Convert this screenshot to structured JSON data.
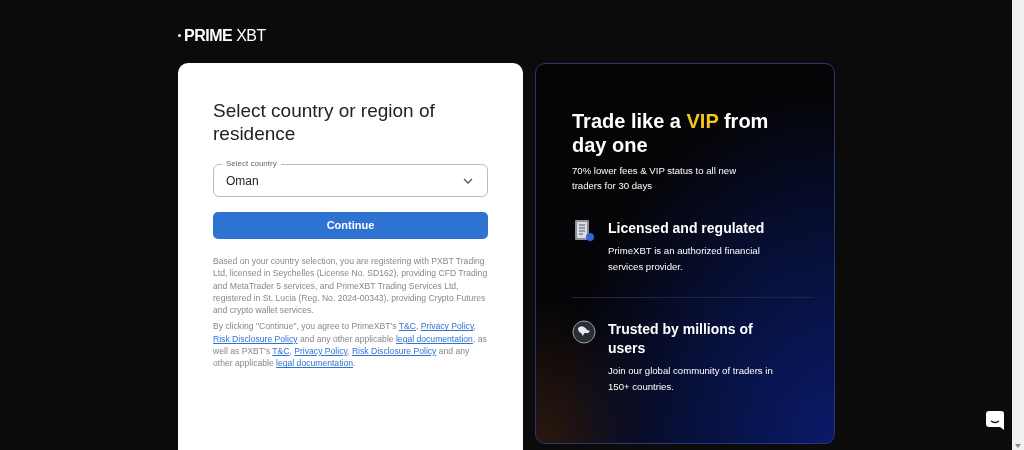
{
  "logo": {
    "prefix": "PRIME",
    "suffix": "XBT"
  },
  "form": {
    "title": "Select country or region of residence",
    "country_field": {
      "label": "Select country",
      "value": "Oman"
    },
    "button": "Continue",
    "disclosure": "Based on your country selection, you are registering with PXBT Trading Ltd, licensed in Seychelles (License No. SD162), providing CFD Trading and MetaTrader 5 services, and PrimeXBT Trading Services Ltd, registered in St. Lucia (Reg. No. 2024-00343), providing Crypto Futures and crypto wallet services.",
    "agreement": [
      {
        "kind": "text",
        "text": "By clicking \"Continue\", you agree to PrimeXBT's "
      },
      {
        "kind": "link",
        "text": "T&C"
      },
      {
        "kind": "text",
        "text": ", "
      },
      {
        "kind": "link",
        "text": "Privacy Policy"
      },
      {
        "kind": "text",
        "text": ", "
      },
      {
        "kind": "link",
        "text": "Risk Disclosure Policy"
      },
      {
        "kind": "text",
        "text": " and any other applicable "
      },
      {
        "kind": "link",
        "text": "legal documentation"
      },
      {
        "kind": "text",
        "text": ", as well as PXBT's "
      },
      {
        "kind": "link",
        "text": "T&C"
      },
      {
        "kind": "text",
        "text": ", "
      },
      {
        "kind": "link",
        "text": "Privacy Policy"
      },
      {
        "kind": "text",
        "text": ", "
      },
      {
        "kind": "link",
        "text": "Risk Disclosure Policy"
      },
      {
        "kind": "text",
        "text": " and any other applicable "
      },
      {
        "kind": "link",
        "text": "legal documentation"
      },
      {
        "kind": "text",
        "text": "."
      }
    ]
  },
  "promo": {
    "title": [
      {
        "text": "Trade like a ",
        "highlight": false
      },
      {
        "text": "VIP",
        "highlight": true
      },
      {
        "text": " from day one",
        "highlight": false
      }
    ],
    "subtitle": "70% lower fees & VIP status to all new traders for 30 days",
    "features": [
      {
        "kind": "document",
        "title": "Licensed and regulated",
        "text": "PrimeXBT is an authorized financial services provider."
      },
      {
        "kind": "globe",
        "title": "Trusted by millions of users",
        "text": "Join our global community of traders in 150+ countries."
      }
    ]
  }
}
